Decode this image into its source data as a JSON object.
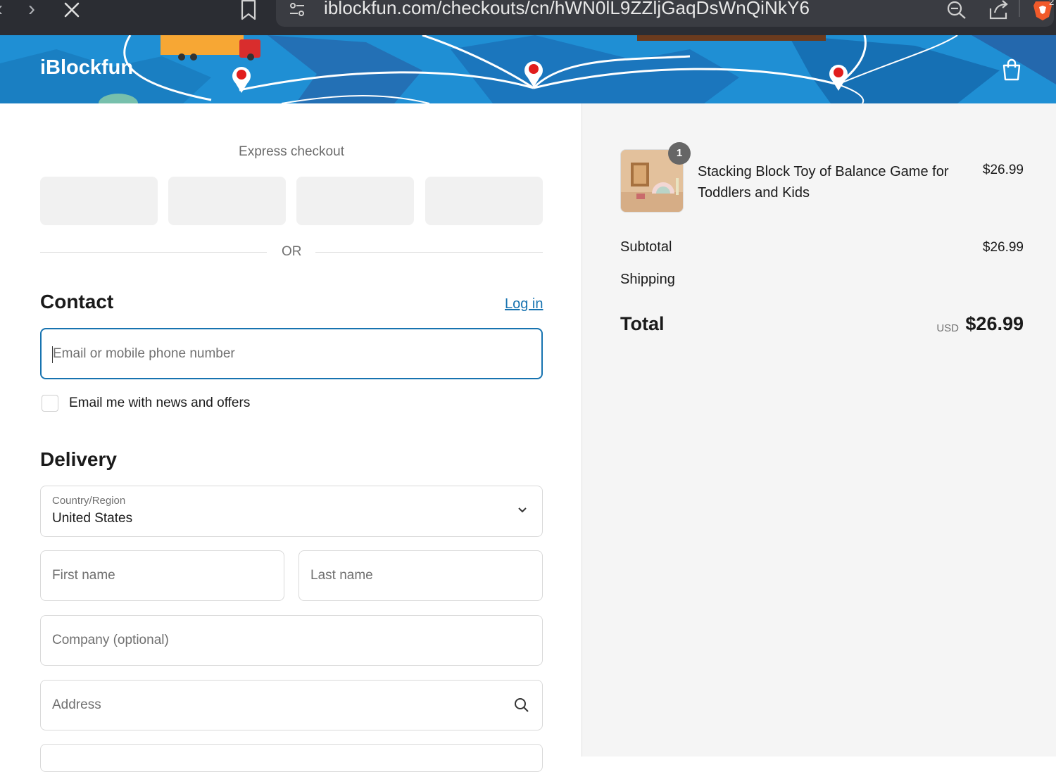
{
  "browser": {
    "url": "iblockfun.com/checkouts/cn/hWN0lL9ZZljGaqDsWnQiNkY6",
    "extension_badge": "2"
  },
  "store": {
    "logo": "iBlockfun"
  },
  "express": {
    "title": "Express checkout",
    "or": "OR"
  },
  "contact": {
    "heading": "Contact",
    "login": "Log in",
    "email_placeholder": "Email or mobile phone number",
    "newsletter_label": "Email me with news and offers"
  },
  "delivery": {
    "heading": "Delivery",
    "country_label": "Country/Region",
    "country_value": "United States",
    "first_name": "First name",
    "last_name": "Last name",
    "company": "Company (optional)",
    "address": "Address"
  },
  "summary": {
    "item": {
      "quantity": "1",
      "name": "Stacking Block Toy of Balance Game for Toddlers and Kids",
      "price": "$26.99"
    },
    "subtotal_label": "Subtotal",
    "subtotal_value": "$26.99",
    "shipping_label": "Shipping",
    "total_label": "Total",
    "total_currency": "USD",
    "total_value": "$26.99"
  },
  "colors": {
    "accent": "#1773b0",
    "header": "#1f8fd4",
    "summary_bg": "#f5f5f5"
  }
}
